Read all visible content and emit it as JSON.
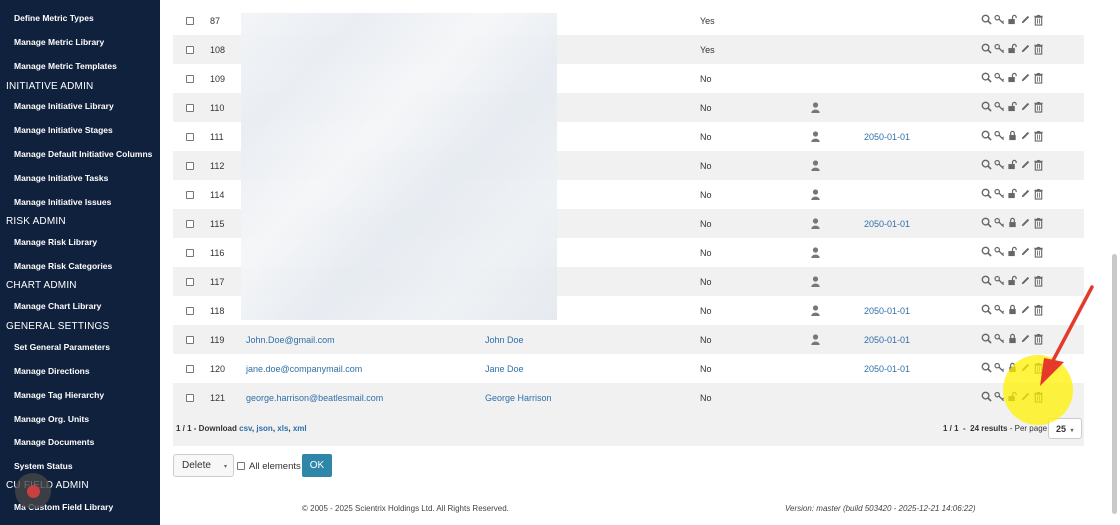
{
  "sidebar": {
    "items_top": [
      {
        "label": "Define Metric Types"
      },
      {
        "label": "Manage Metric Library"
      },
      {
        "label": "Manage Metric Templates"
      }
    ],
    "section_initiative": "INITIATIVE ADMIN",
    "initiative_items": [
      {
        "label": "Manage Initiative Library"
      },
      {
        "label": "Manage Initiative Stages"
      },
      {
        "label": "Manage Default Initiative Columns"
      },
      {
        "label": "Manage Initiative Tasks"
      },
      {
        "label": "Manage Initiative Issues"
      }
    ],
    "section_risk": "RISK ADMIN",
    "risk_items": [
      {
        "label": "Manage Risk Library"
      },
      {
        "label": "Manage Risk Categories"
      }
    ],
    "section_chart": "CHART ADMIN",
    "chart_items": [
      {
        "label": "Manage Chart Library"
      }
    ],
    "section_general": "GENERAL SETTINGS",
    "general_items": [
      {
        "label": "Set General Parameters"
      },
      {
        "label": "Manage Directions"
      },
      {
        "label": "Manage Tag Hierarchy"
      },
      {
        "label": "Manage Org. Units"
      },
      {
        "label": "Manage Documents"
      },
      {
        "label": "System Status"
      }
    ],
    "section_custom": "CU        FIELD ADMIN",
    "custom_items": [
      {
        "label": "Ma     Custom Field Library"
      }
    ]
  },
  "rows": [
    {
      "num": "87",
      "email": "",
      "name": "",
      "yn": "Yes",
      "person": false,
      "date": "",
      "locked": false
    },
    {
      "num": "108",
      "email": "",
      "name": "",
      "yn": "Yes",
      "person": false,
      "date": "",
      "locked": false
    },
    {
      "num": "109",
      "email": "",
      "name": "",
      "yn": "No",
      "person": false,
      "date": "",
      "locked": false
    },
    {
      "num": "110",
      "email": "",
      "name": "",
      "yn": "No",
      "person": true,
      "date": "",
      "locked": false
    },
    {
      "num": "111",
      "email": "",
      "name": "",
      "yn": "No",
      "person": true,
      "date": "2050-01-01",
      "locked": true
    },
    {
      "num": "112",
      "email": "",
      "name": "",
      "yn": "No",
      "person": true,
      "date": "",
      "locked": false
    },
    {
      "num": "114",
      "email": "",
      "name": "",
      "yn": "No",
      "person": true,
      "date": "",
      "locked": false
    },
    {
      "num": "115",
      "email": "",
      "name": "",
      "yn": "No",
      "person": true,
      "date": "2050-01-01",
      "locked": true
    },
    {
      "num": "116",
      "email": "",
      "name": "",
      "yn": "No",
      "person": true,
      "date": "",
      "locked": false
    },
    {
      "num": "117",
      "email": "",
      "name": "",
      "yn": "No",
      "person": true,
      "date": "",
      "locked": false
    },
    {
      "num": "118",
      "email": "",
      "name": "",
      "yn": "No",
      "person": true,
      "date": "2050-01-01",
      "locked": true
    },
    {
      "num": "119",
      "email": "John.Doe@gmail.com",
      "name": "John Doe",
      "yn": "No",
      "person": true,
      "date": "2050-01-01",
      "locked": true
    },
    {
      "num": "120",
      "email": "jane.doe@companymail.com",
      "name": "Jane Doe",
      "yn": "No",
      "person": false,
      "date": "2050-01-01",
      "locked": true
    },
    {
      "num": "121",
      "email": "george.harrison@beatlesmail.com",
      "name": "George Harrison",
      "yn": "No",
      "person": false,
      "date": "",
      "locked": false
    }
  ],
  "footer": {
    "download_prefix": "1 / 1 - Download",
    "download_links": [
      "csv",
      "json",
      "xls",
      "xml"
    ],
    "pagination": "1 / 1",
    "results": "24 results",
    "perpage_label": "- Per page",
    "perpage_value": "25"
  },
  "bulk": {
    "action": "Delete",
    "all_label": "All elements",
    "ok_label": "OK"
  },
  "copyright": "© 2005 - 2025 Scientrix Holdings Ltd. All Rights Reserved.",
  "version": "Version: master (build 503420 - 2025-12-21 14:06:22)",
  "colors": {
    "sidebar_bg": "#10213d",
    "link": "#2f6fa8",
    "ok_button": "#2e86a8",
    "annotation_arrow": "#e53a2a",
    "annotation_highlight": "#fff000"
  },
  "icons": [
    "search-icon",
    "key-icon",
    "lock-icon",
    "edit-icon",
    "trash-icon",
    "user-icon",
    "arrow-annotation-icon"
  ]
}
